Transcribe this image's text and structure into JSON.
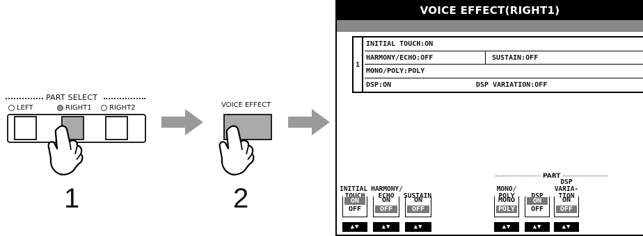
{
  "part_select": {
    "title": "PART SELECT",
    "lights": [
      "LEFT",
      "RIGHT1",
      "RIGHT2"
    ],
    "active_light": "RIGHT1"
  },
  "steps": {
    "step1": "1",
    "step2": "2"
  },
  "voice_effect_button": {
    "label": "VOICE EFFECT"
  },
  "lcd": {
    "title": "VOICE EFFECT(RIGHT1)",
    "list_index": "1",
    "rows": {
      "initial_touch": "INITIAL TOUCH:ON",
      "harmony_echo": "HARMONY/ECHO:OFF",
      "sustain": "SUSTAIN:OFF",
      "mono_poly": "MONO/POLY:POLY",
      "dsp": "DSP:ON",
      "dsp_variation": "DSP VARIATION:OFF"
    },
    "group_label": "PART",
    "controls": {
      "initial_touch": {
        "label1": "INITIAL",
        "label2": "TOUCH",
        "opt1": "ON",
        "opt2": "OFF",
        "selected": "ON"
      },
      "harmony_echo": {
        "label1": "HARMONY/",
        "label2": "ECHO",
        "opt1": "ON",
        "opt2": "OFF",
        "selected": "OFF"
      },
      "sustain": {
        "label1": "SUSTAIN",
        "opt1": "ON",
        "opt2": "OFF",
        "selected": "OFF"
      },
      "mono_poly": {
        "label1": "MONO/",
        "label2": "POLY",
        "opt1": "MONO",
        "opt2": "POLY",
        "selected": "POLY"
      },
      "dsp": {
        "label1": "DSP",
        "opt1": "ON",
        "opt2": "OFF",
        "selected": "ON"
      },
      "dsp_variation": {
        "label1": "DSP",
        "label2": "VARIA-",
        "label3": "TION",
        "opt1": "ON",
        "opt2": "OFF",
        "selected": "OFF"
      }
    },
    "arrow_key_glyph": "▲▼"
  },
  "colors": {
    "lcd_title_bg": "#000000",
    "lcd_bar": "#8a8a8a",
    "selected_option": "#777777",
    "pressed_button": "#aaaaaa",
    "arrow": "#9a9a9a"
  }
}
